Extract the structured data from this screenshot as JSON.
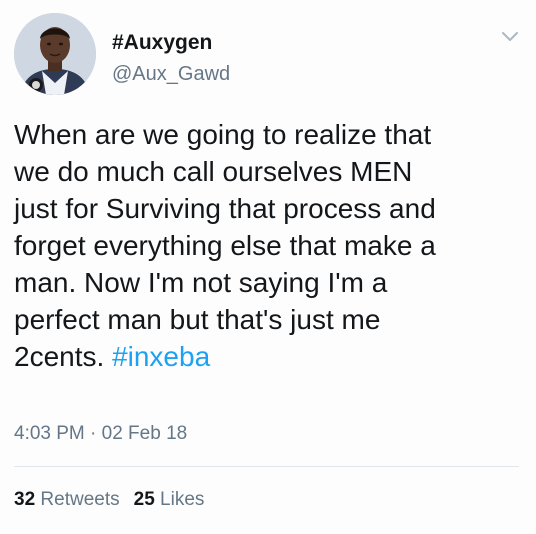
{
  "tweet": {
    "display_name": "#Auxygen",
    "handle": "@Aux_Gawd",
    "text_lines": [
      "When are we going to realize that",
      "we do much call ourselves MEN",
      "just for Surviving that process and",
      "forget everything else that make a",
      "man. Now I'm not saying I'm a",
      "perfect man but that's just me"
    ],
    "last_line_prefix": "2cents. ",
    "hashtag": "#inxeba",
    "timestamp": "4:03 PM · 02 Feb 18",
    "stats": {
      "retweets_count": "32",
      "retweets_label": "Retweets",
      "likes_count": "25",
      "likes_label": "Likes"
    }
  },
  "colors": {
    "hashtag": "#1da1f2",
    "secondary_text": "#657786",
    "primary_text": "#14171a",
    "divider": "#e1e8ed"
  },
  "icons": {
    "menu": "chevron-down-icon",
    "avatar": "user-avatar"
  }
}
